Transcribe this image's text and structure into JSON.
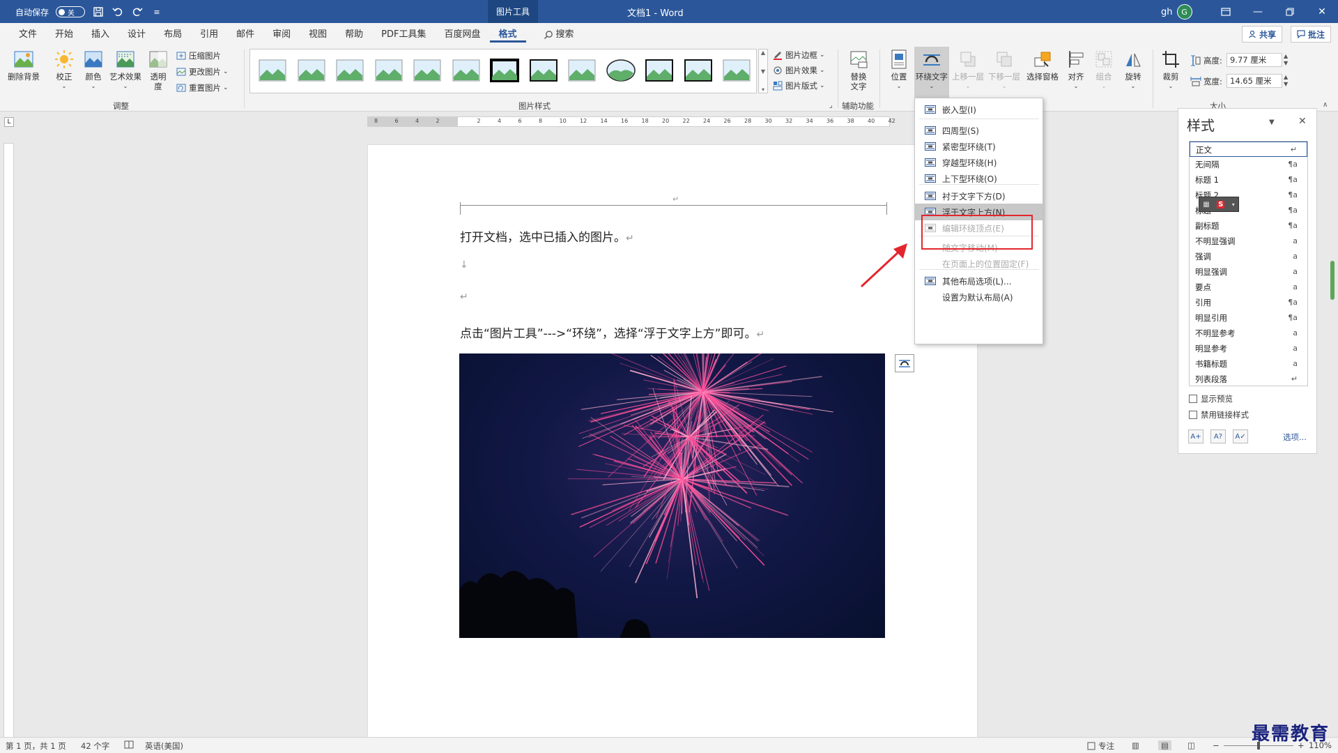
{
  "titlebar": {
    "autosave_label": "自动保存",
    "autosave_state": "关",
    "picture_tools_tab": "图片工具",
    "doc_title": "文档1  -  Word",
    "user_initials": "gh",
    "avatar_letter": "G"
  },
  "tabs": [
    "文件",
    "开始",
    "插入",
    "设计",
    "布局",
    "引用",
    "邮件",
    "审阅",
    "视图",
    "帮助",
    "PDF工具集",
    "百度网盘",
    "格式"
  ],
  "search_label": "搜索",
  "share_label": "共享",
  "comment_label": "批注",
  "ribbon": {
    "remove_bg": "删除背景",
    "corrections": "校正",
    "color": "颜色",
    "artistic": "艺术效果",
    "transparency_1": "透明",
    "transparency_2": "度",
    "compress": "压缩图片",
    "change_picture": "更改图片",
    "reset_picture": "重置图片",
    "adjust_group": "调整",
    "picture_border": "图片边框",
    "picture_effects": "图片效果",
    "picture_layout": "图片版式",
    "picture_styles_group": "图片样式",
    "alt_text_1": "替换",
    "alt_text_2": "文字",
    "accessibility_group": "辅助功能",
    "position": "位置",
    "wrap_text": "环绕文字",
    "bring_forward": "上移一层",
    "send_backward": "下移一层",
    "selection_pane": "选择窗格",
    "align": "对齐",
    "group": "组合",
    "rotate": "旋转",
    "crop": "裁剪",
    "height_label": "高度:",
    "height_value": "9.77 厘米",
    "width_label": "宽度:",
    "width_value": "14.65 厘米",
    "size_group": "大小"
  },
  "document": {
    "para1": "打开文档，选中已插入的图片。",
    "para2": "点击“图片工具”--->“环绕”，选择“浮于文字上方”即可。",
    "pilcrow": "↵",
    "down_arrow": "↓"
  },
  "wrap_menu": {
    "items": [
      {
        "label": "嵌入型(I)",
        "state": "normal"
      },
      {
        "label": "四周型(S)",
        "state": "normal"
      },
      {
        "label": "紧密型环绕(T)",
        "state": "normal"
      },
      {
        "label": "穿越型环绕(H)",
        "state": "normal"
      },
      {
        "label": "上下型环绕(O)",
        "state": "normal"
      },
      {
        "label": "衬于文字下方(D)",
        "state": "normal"
      },
      {
        "label": "浮于文字上方(N)",
        "state": "selected"
      },
      {
        "label": "编辑环绕顶点(E)",
        "state": "disabled"
      },
      {
        "label": "随文字移动(M)",
        "state": "disabled"
      },
      {
        "label": "在页面上的位置固定(F)",
        "state": "disabled"
      },
      {
        "label": "其他布局选项(L)...",
        "state": "normal"
      },
      {
        "label": "设置为默认布局(A)",
        "state": "normal"
      }
    ]
  },
  "styles_pane": {
    "title": "样式",
    "items": [
      {
        "name": "正文",
        "sym": "↵"
      },
      {
        "name": "无间隔",
        "sym": "¶a"
      },
      {
        "name": "标题 1",
        "sym": "¶a"
      },
      {
        "name": "标题 2",
        "sym": "¶a"
      },
      {
        "name": "标题",
        "sym": "¶a"
      },
      {
        "name": "副标题",
        "sym": "¶a"
      },
      {
        "name": "不明显强调",
        "sym": "a"
      },
      {
        "name": "强调",
        "sym": "a"
      },
      {
        "name": "明显强调",
        "sym": "a"
      },
      {
        "name": "要点",
        "sym": "a"
      },
      {
        "name": "引用",
        "sym": "¶a"
      },
      {
        "name": "明显引用",
        "sym": "¶a"
      },
      {
        "name": "不明显参考",
        "sym": "a"
      },
      {
        "name": "明显参考",
        "sym": "a"
      },
      {
        "name": "书籍标题",
        "sym": "a"
      },
      {
        "name": "列表段落",
        "sym": "↵"
      }
    ],
    "show_preview": "显示预览",
    "disable_linked": "禁用链接样式",
    "options": "选项..."
  },
  "statusbar": {
    "page": "第 1 页，共 1 页",
    "words": "42 个字",
    "language": "英语(美国)",
    "focus": "专注",
    "zoom": "110%"
  },
  "watermark": "最需教育",
  "ruler_ticks": [
    "8",
    "6",
    "4",
    "2",
    "",
    "2",
    "4",
    "6",
    "8",
    "10",
    "12",
    "14",
    "16",
    "18",
    "20",
    "22",
    "24",
    "26",
    "28",
    "30",
    "32",
    "34",
    "36",
    "38",
    "40",
    "42"
  ],
  "colors": {
    "brand": "#2b579a",
    "highlight": "#e3262e"
  }
}
